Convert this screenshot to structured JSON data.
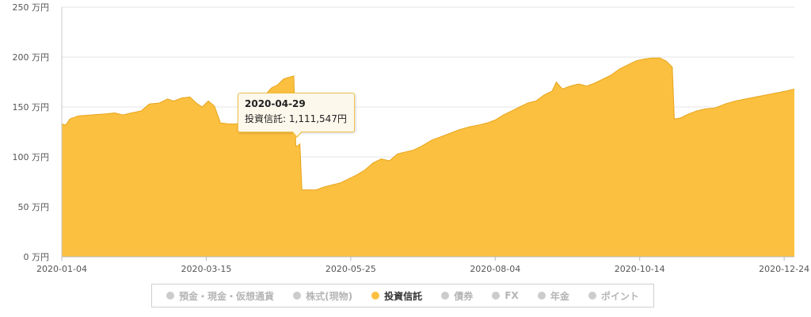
{
  "chart_data": {
    "type": "area",
    "y_unit": "万円",
    "ylim": [
      0,
      250
    ],
    "y_ticks": [
      {
        "value": 0,
        "label": "0 万円"
      },
      {
        "value": 50,
        "label": "50 万円"
      },
      {
        "value": 100,
        "label": "100 万円"
      },
      {
        "value": 150,
        "label": "150 万円"
      },
      {
        "value": 200,
        "label": "200 万円"
      },
      {
        "value": 250,
        "label": "250 万円"
      }
    ],
    "x_ticks": [
      "2020-01-04",
      "2020-03-15",
      "2020-05-25",
      "2020-08-04",
      "2020-10-14",
      "2020-12-24"
    ],
    "xlim": [
      "2020-01-04",
      "2020-12-29"
    ],
    "grid": true,
    "series": [
      {
        "name": "投資信託",
        "color": "#fcc040",
        "line_color": "#e6a419",
        "points": [
          [
            "2020-01-04",
            133
          ],
          [
            "2020-01-06",
            132
          ],
          [
            "2020-01-08",
            138
          ],
          [
            "2020-01-12",
            141
          ],
          [
            "2020-01-18",
            142
          ],
          [
            "2020-01-25",
            143
          ],
          [
            "2020-01-30",
            144
          ],
          [
            "2020-02-03",
            142
          ],
          [
            "2020-02-07",
            144
          ],
          [
            "2020-02-12",
            146
          ],
          [
            "2020-02-16",
            153
          ],
          [
            "2020-02-21",
            154
          ],
          [
            "2020-02-25",
            158
          ],
          [
            "2020-02-28",
            156
          ],
          [
            "2020-03-03",
            159
          ],
          [
            "2020-03-07",
            160
          ],
          [
            "2020-03-10",
            154
          ],
          [
            "2020-03-13",
            150
          ],
          [
            "2020-03-16",
            156
          ],
          [
            "2020-03-19",
            151
          ],
          [
            "2020-03-22",
            134
          ],
          [
            "2020-03-26",
            133
          ],
          [
            "2020-03-30",
            133
          ],
          [
            "2020-04-02",
            135
          ],
          [
            "2020-04-04",
            148
          ],
          [
            "2020-04-07",
            155
          ],
          [
            "2020-04-10",
            160
          ],
          [
            "2020-04-13",
            162
          ],
          [
            "2020-04-16",
            169
          ],
          [
            "2020-04-19",
            172
          ],
          [
            "2020-04-22",
            178
          ],
          [
            "2020-04-25",
            180
          ],
          [
            "2020-04-27",
            181
          ],
          [
            "2020-04-28",
            111
          ],
          [
            "2020-04-29",
            111.15
          ],
          [
            "2020-04-30",
            113
          ],
          [
            "2020-05-01",
            67
          ],
          [
            "2020-05-08",
            67
          ],
          [
            "2020-05-12",
            70
          ],
          [
            "2020-05-16",
            72
          ],
          [
            "2020-05-20",
            74
          ],
          [
            "2020-05-24",
            78
          ],
          [
            "2020-05-28",
            82
          ],
          [
            "2020-06-01",
            87
          ],
          [
            "2020-06-05",
            94
          ],
          [
            "2020-06-09",
            98
          ],
          [
            "2020-06-13",
            96
          ],
          [
            "2020-06-17",
            103
          ],
          [
            "2020-06-21",
            105
          ],
          [
            "2020-06-25",
            107
          ],
          [
            "2020-06-29",
            111
          ],
          [
            "2020-07-04",
            117
          ],
          [
            "2020-07-08",
            120
          ],
          [
            "2020-07-12",
            123
          ],
          [
            "2020-07-17",
            127
          ],
          [
            "2020-07-22",
            130
          ],
          [
            "2020-07-27",
            132
          ],
          [
            "2020-07-31",
            134
          ],
          [
            "2020-08-04",
            137
          ],
          [
            "2020-08-08",
            142
          ],
          [
            "2020-08-12",
            146
          ],
          [
            "2020-08-16",
            150
          ],
          [
            "2020-08-20",
            154
          ],
          [
            "2020-08-24",
            156
          ],
          [
            "2020-08-28",
            162
          ],
          [
            "2020-09-01",
            166
          ],
          [
            "2020-09-03",
            175
          ],
          [
            "2020-09-06",
            168
          ],
          [
            "2020-09-10",
            171
          ],
          [
            "2020-09-14",
            173
          ],
          [
            "2020-09-18",
            171
          ],
          [
            "2020-09-22",
            174
          ],
          [
            "2020-09-26",
            178
          ],
          [
            "2020-09-30",
            182
          ],
          [
            "2020-10-04",
            188
          ],
          [
            "2020-10-08",
            192
          ],
          [
            "2020-10-12",
            196
          ],
          [
            "2020-10-16",
            198
          ],
          [
            "2020-10-20",
            199
          ],
          [
            "2020-10-24",
            199
          ],
          [
            "2020-10-27",
            196
          ],
          [
            "2020-10-30",
            190
          ],
          [
            "2020-10-31",
            138
          ],
          [
            "2020-11-03",
            139
          ],
          [
            "2020-11-07",
            143
          ],
          [
            "2020-11-11",
            146
          ],
          [
            "2020-11-15",
            148
          ],
          [
            "2020-11-20",
            149
          ],
          [
            "2020-11-25",
            153
          ],
          [
            "2020-11-30",
            156
          ],
          [
            "2020-12-05",
            158
          ],
          [
            "2020-12-10",
            160
          ],
          [
            "2020-12-15",
            162
          ],
          [
            "2020-12-20",
            164
          ],
          [
            "2020-12-25",
            166
          ],
          [
            "2020-12-29",
            168
          ]
        ]
      }
    ]
  },
  "tooltip": {
    "title": "2020-04-29",
    "series_label": "投資信託",
    "value": "1,111,547円"
  },
  "legend": {
    "items": [
      {
        "label": "預金・現金・仮想通貨",
        "color": "#cccccc",
        "active": false
      },
      {
        "label": "株式(現物)",
        "color": "#cccccc",
        "active": false
      },
      {
        "label": "投資信託",
        "color": "#fcc040",
        "active": true
      },
      {
        "label": "債券",
        "color": "#cccccc",
        "active": false
      },
      {
        "label": "FX",
        "color": "#cccccc",
        "active": false
      },
      {
        "label": "年金",
        "color": "#cccccc",
        "active": false
      },
      {
        "label": "ポイント",
        "color": "#cccccc",
        "active": false
      }
    ]
  }
}
